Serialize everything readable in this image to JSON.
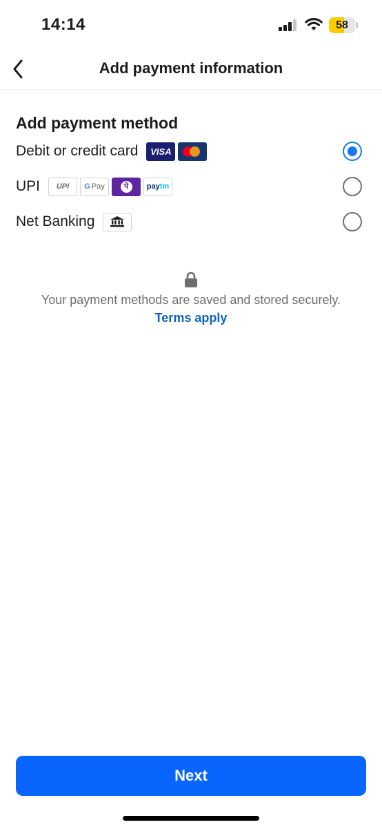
{
  "status_bar": {
    "time": "14:14",
    "battery_level": "58",
    "battery_fraction": 0.58,
    "signal_bars": 3,
    "battery_color": "#ffcc00"
  },
  "header": {
    "title": "Add payment information",
    "back_icon": "chevron-left-icon"
  },
  "section": {
    "title": "Add payment method"
  },
  "methods": [
    {
      "label": "Debit or credit card",
      "selected": true,
      "logos": [
        "visa-logo",
        "mastercard-logo"
      ]
    },
    {
      "label": "UPI",
      "selected": false,
      "logos": [
        "upi-logo",
        "google-pay-logo",
        "phonepe-logo",
        "paytm-logo"
      ]
    },
    {
      "label": "Net Banking",
      "selected": false,
      "logos": [
        "bank-icon"
      ]
    }
  ],
  "logos": {
    "visa": "VISA",
    "upi": "UPI",
    "gpay_g": "G",
    "gpay": "Pay",
    "phonepe": "पे",
    "paytm_a": "pay",
    "paytm_b": "tm"
  },
  "security": {
    "icon": "lock-icon",
    "message": "Your payment methods are saved and stored securely.",
    "terms_link": "Terms apply"
  },
  "footer": {
    "next_label": "Next"
  },
  "colors": {
    "accent": "#1877f2",
    "button": "#0866ff",
    "link": "#0a66c2"
  }
}
